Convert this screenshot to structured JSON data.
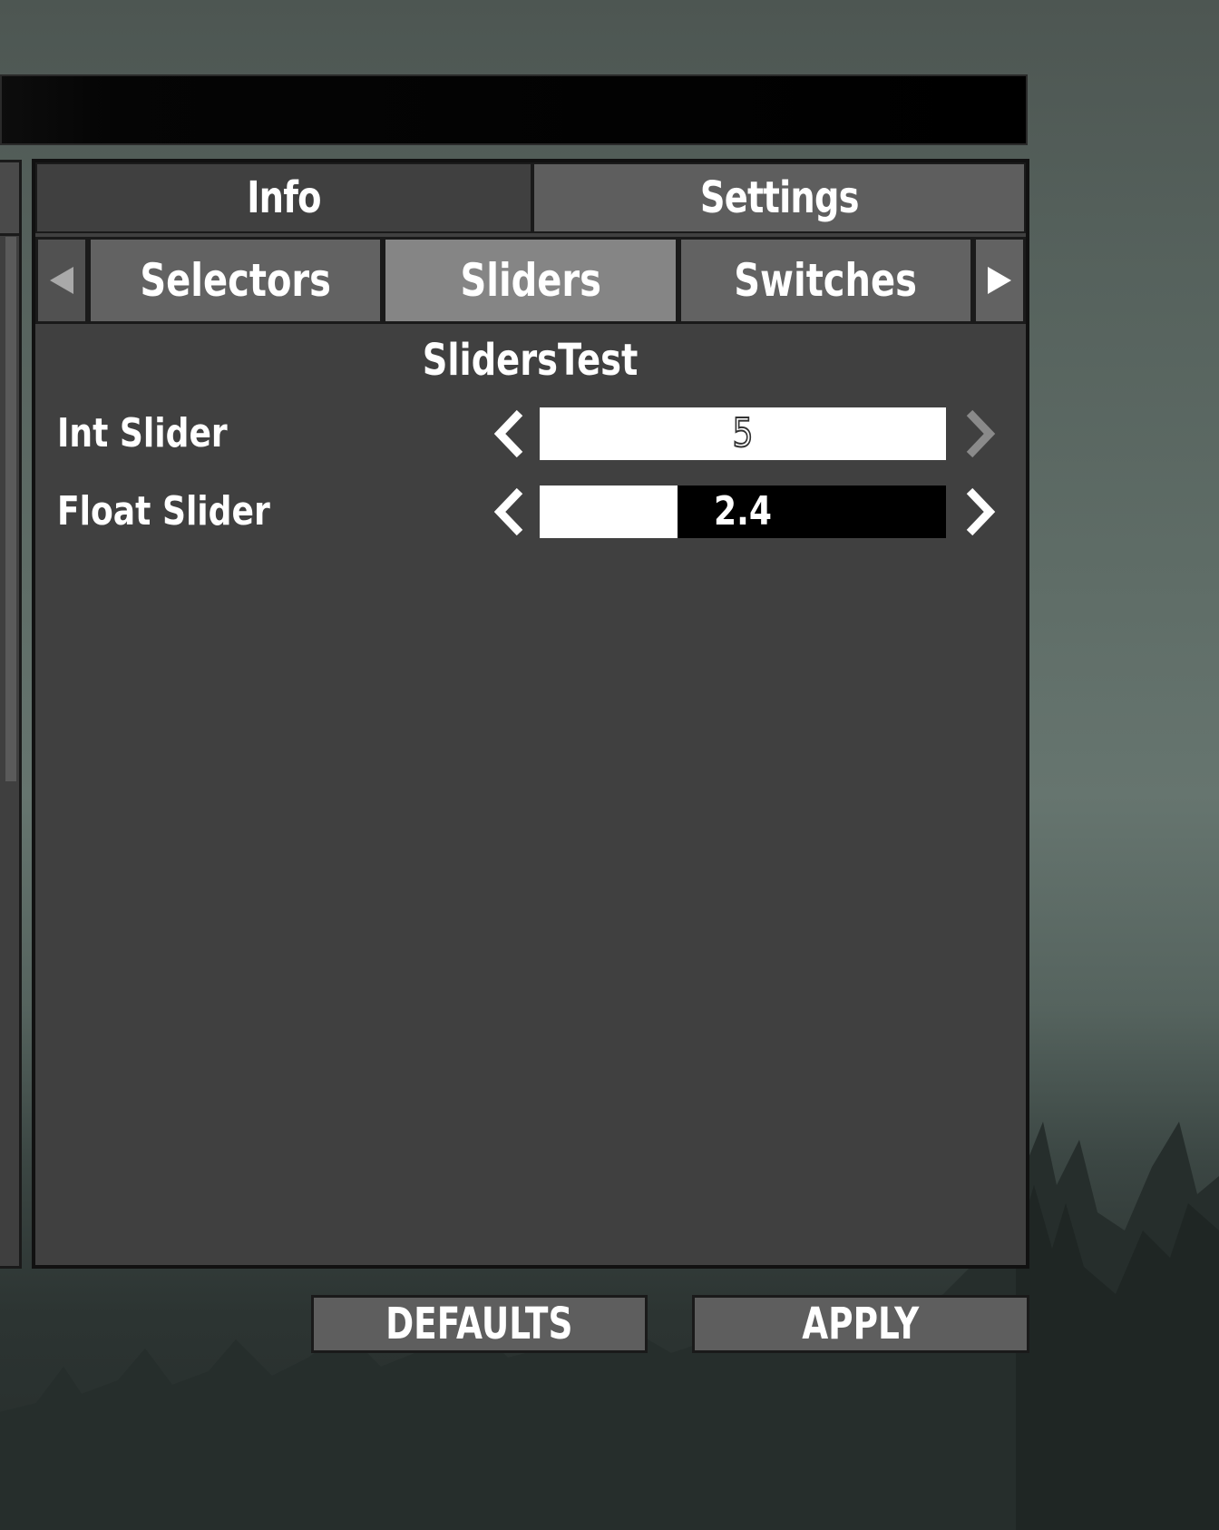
{
  "main_tabs": [
    {
      "label": "Info",
      "active": false
    },
    {
      "label": "Settings",
      "active": true
    }
  ],
  "sub_tabs": [
    {
      "label": "Selectors",
      "active": false
    },
    {
      "label": "Sliders",
      "active": true
    },
    {
      "label": "Switches",
      "active": false
    }
  ],
  "section": {
    "title": "SlidersTest"
  },
  "sliders": [
    {
      "label": "Int Slider",
      "value": "5",
      "fill_fraction": 1.0,
      "left_enabled": true,
      "right_enabled": false
    },
    {
      "label": "Float Slider",
      "value": "2.4",
      "fill_fraction": 0.34,
      "left_enabled": true,
      "right_enabled": true
    }
  ],
  "footer": {
    "defaults_label": "DEFAULTS",
    "apply_label": "APPLY"
  },
  "colors": {
    "panel": "#404040",
    "tab_active": "#858585",
    "tab_inactive": "#626262",
    "arrow_disabled": "#8a8a8a"
  }
}
